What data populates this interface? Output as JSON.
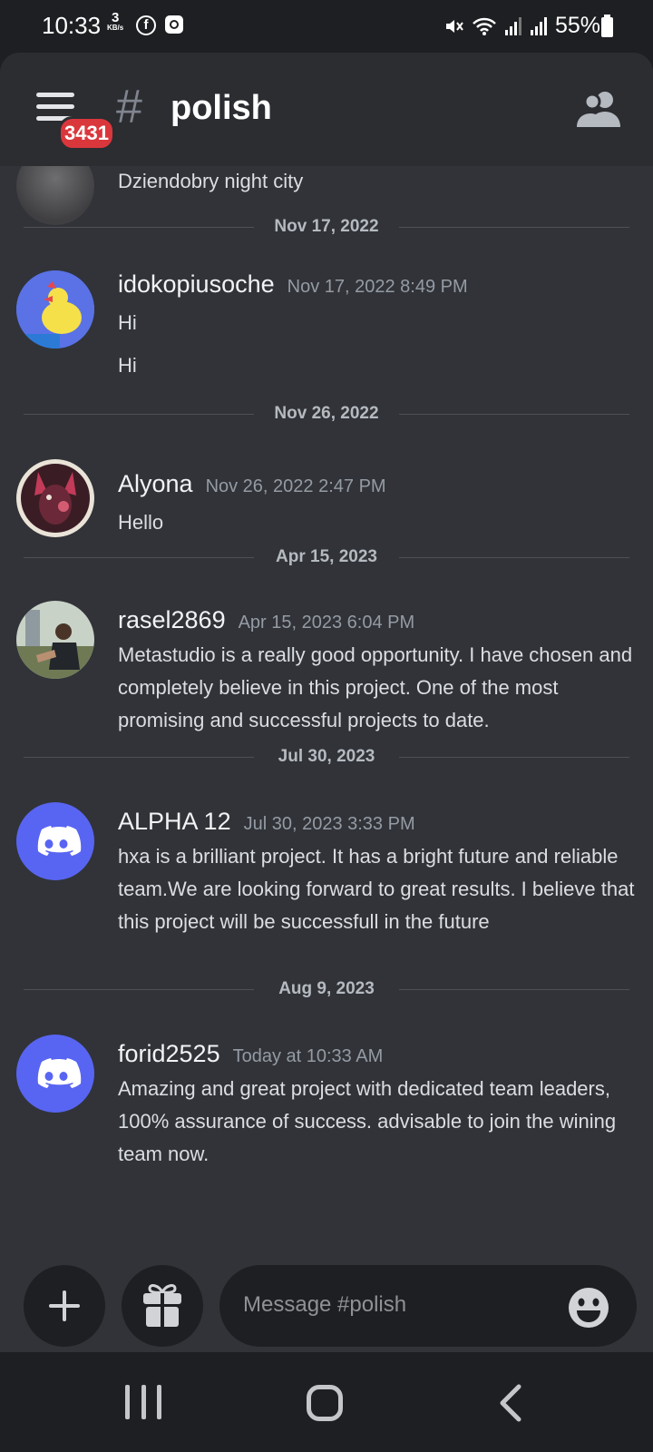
{
  "status_bar": {
    "time": "10:33",
    "speed_value": "3",
    "speed_unit": "KB/s",
    "battery": "55%"
  },
  "header": {
    "badge_count": "3431",
    "channel_name": "polish",
    "icons": [
      "menu-icon",
      "hash-icon",
      "members-icon"
    ]
  },
  "messages": {
    "partial": {
      "text": "Dziendobry night city"
    },
    "dividers": [
      "Nov 17, 2022",
      "Nov 26, 2022",
      "Apr 15, 2023",
      "Jul 30, 2023",
      "Aug 9, 2023"
    ],
    "items": [
      {
        "author": "idokopiusoche",
        "timestamp": "Nov 17, 2022 8:49 PM",
        "lines": [
          "Hi",
          "Hi"
        ]
      },
      {
        "author": "Alyona",
        "timestamp": "Nov 26, 2022 2:47 PM",
        "lines": [
          "Hello"
        ]
      },
      {
        "author": "rasel2869",
        "timestamp": "Apr 15, 2023 6:04 PM",
        "lines": [
          "Metastudio is a really good opportunity. I have chosen and completely believe in this project. One of the most promising and successful projects to date."
        ]
      },
      {
        "author": "ALPHA 12",
        "timestamp": "Jul 30, 2023 3:33 PM",
        "lines": [
          "hxa is a brilliant project. It has a bright future and reliable team.We are looking forward to great results. I believe that this project will be successfull in the future"
        ]
      },
      {
        "author": "forid2525",
        "timestamp": "Today at 10:33 AM",
        "lines": [
          "Amazing and great project with dedicated team leaders, 100% assurance of success. advisable to join the wining team now."
        ]
      }
    ]
  },
  "composer": {
    "placeholder": "Message #polish",
    "icons": [
      "plus-icon",
      "gift-icon",
      "emoji-icon"
    ]
  },
  "colors": {
    "background": "#313338",
    "header": "#2b2d31",
    "blurple": "#5865f2",
    "badge": "#da373c"
  }
}
